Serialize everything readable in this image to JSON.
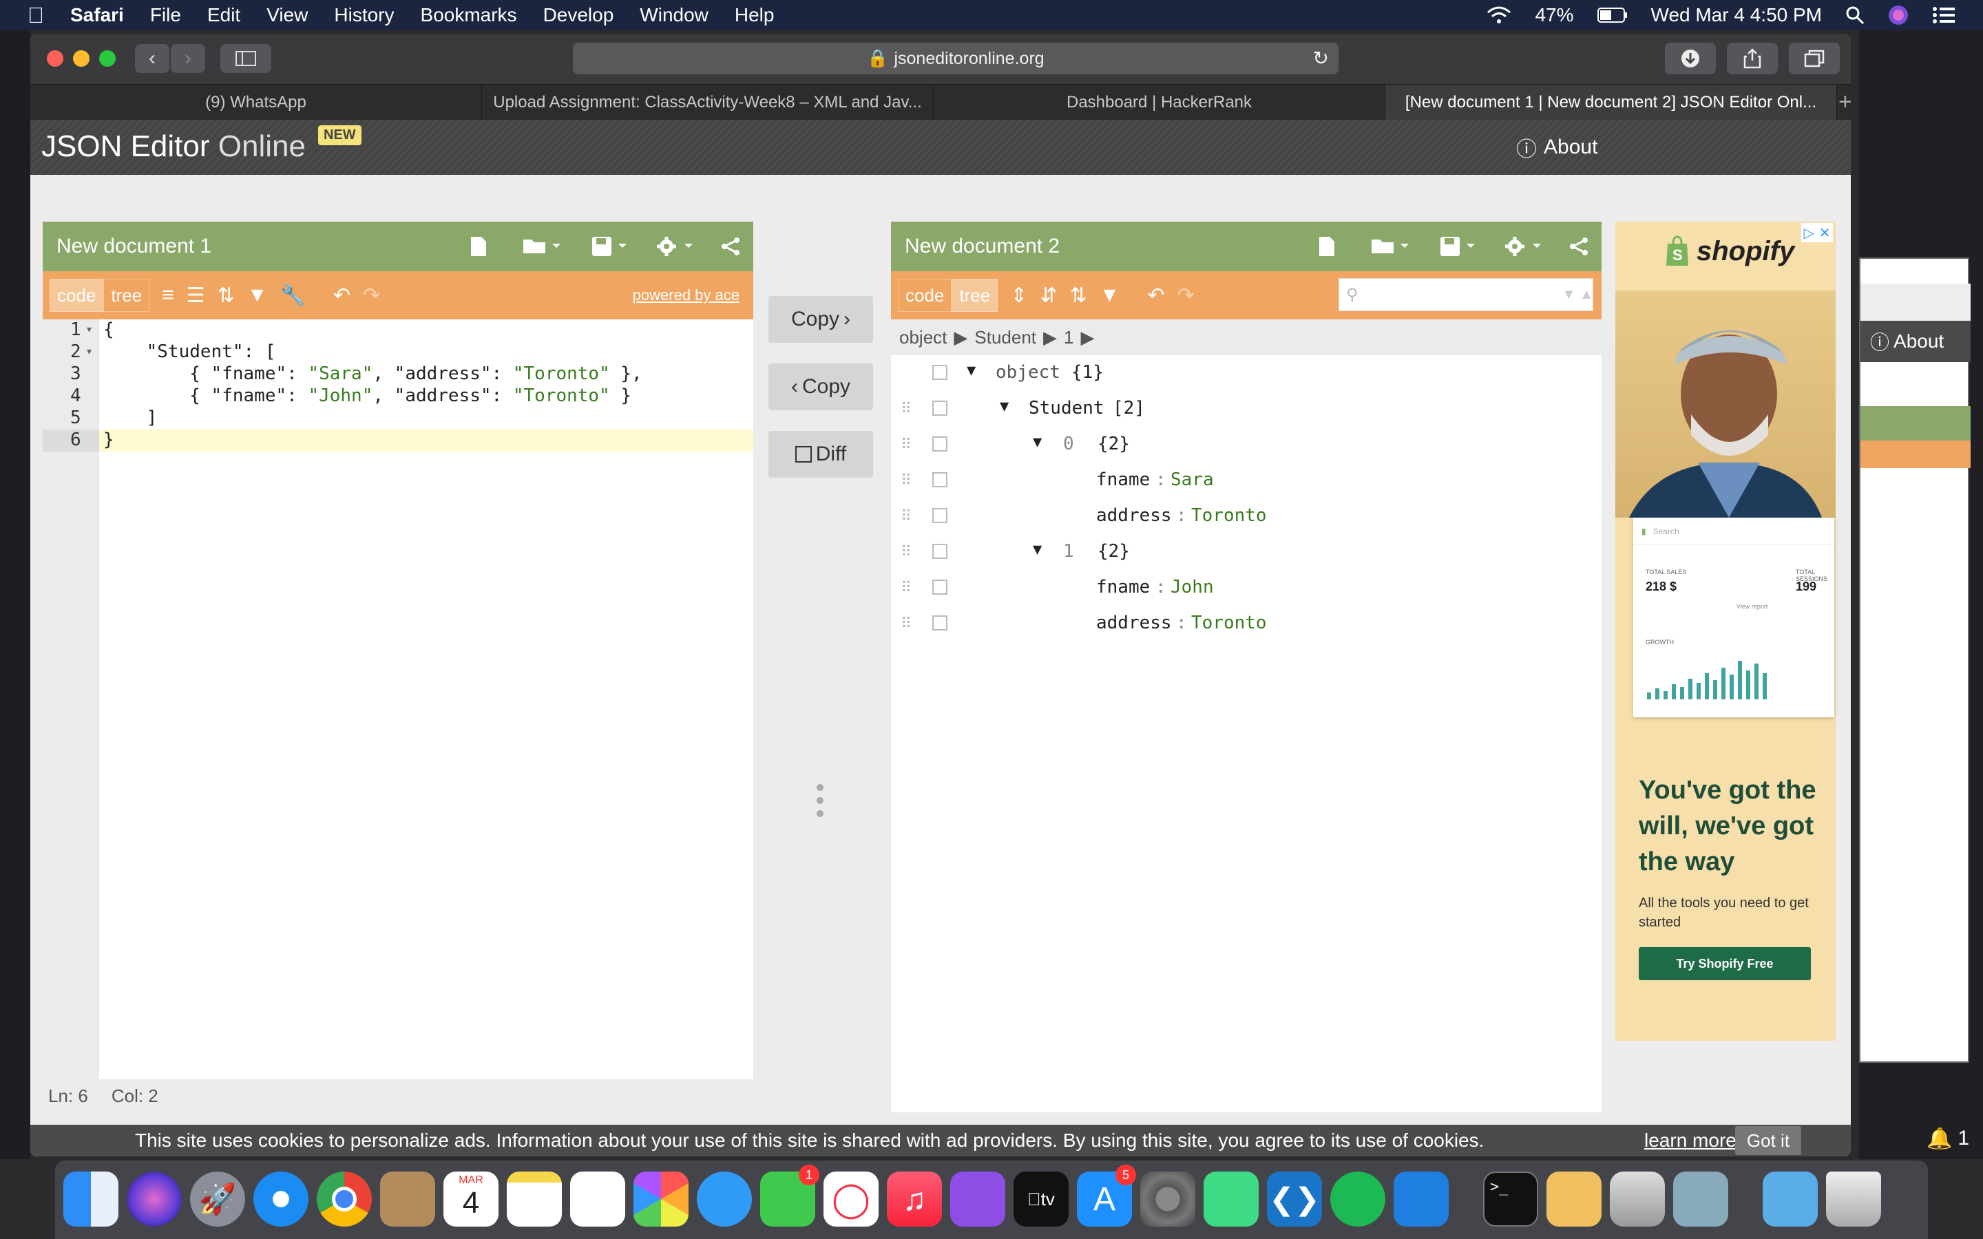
{
  "menubar": {
    "app_name": "Safari",
    "menus": [
      "File",
      "Edit",
      "View",
      "History",
      "Bookmarks",
      "Develop",
      "Window",
      "Help"
    ],
    "battery": "47%",
    "datetime": "Wed Mar 4  4:50 PM"
  },
  "browser": {
    "url": "jsoneditoronline.org",
    "tabs": [
      {
        "label": "(9) WhatsApp"
      },
      {
        "label": "Upload Assignment: ClassActivity-Week8 – XML and Jav..."
      },
      {
        "label": "Dashboard | HackerRank"
      },
      {
        "label": "[New document 1 | New document 2]  JSON Editor Onl..."
      }
    ]
  },
  "app": {
    "logo_main": "JSON Editor",
    "logo_sub": "Online",
    "badge": "NEW",
    "about": "About"
  },
  "left_panel": {
    "title": "New document 1",
    "mode_code": "code",
    "mode_tree": "tree",
    "powered_by": "powered by ace",
    "line_numbers": [
      "1",
      "2",
      "3",
      "4",
      "5",
      "6"
    ],
    "status_ln": "Ln: 6",
    "status_col": "Col: 2"
  },
  "code_lines": [
    {
      "pre": "{",
      "k1": "",
      "m1": "",
      "v1": "",
      "m2": "",
      "v2": "",
      "post": ""
    },
    {
      "pre": "    ",
      "k1": "\"Student\"",
      "m1": ": [",
      "v1": "",
      "m2": "",
      "v2": "",
      "post": ""
    },
    {
      "pre": "        { ",
      "k1": "\"fname\"",
      "m1": ": ",
      "v1": "\"Sara\"",
      "m2": ", \"address\": ",
      "v2": "\"Toronto\"",
      "post": " },"
    },
    {
      "pre": "        { ",
      "k1": "\"fname\"",
      "m1": ": ",
      "v1": "\"John\"",
      "m2": ", \"address\": ",
      "v2": "\"Toronto\"",
      "post": " }"
    },
    {
      "pre": "    ]",
      "k1": "",
      "m1": "",
      "v1": "",
      "m2": "",
      "v2": "",
      "post": ""
    },
    {
      "pre": "}",
      "k1": "",
      "m1": "",
      "v1": "",
      "m2": "",
      "v2": "",
      "post": ""
    }
  ],
  "middle": {
    "copy_right": "Copy",
    "copy_left": "Copy",
    "diff": "Diff"
  },
  "right_panel": {
    "title": "New document 2",
    "mode_code": "code",
    "mode_tree": "tree",
    "breadcrumb": [
      "object",
      "Student",
      "1"
    ],
    "search_placeholder": ""
  },
  "tree": {
    "root_label": "object",
    "root_count": "{1}",
    "student_label": "Student",
    "student_count": "[2]",
    "item0_index": "0",
    "item0_count": "{2}",
    "item1_index": "1",
    "item1_count": "{2}",
    "fname_key": "fname",
    "address_key": "address",
    "sep": ":",
    "sara": "Sara",
    "john": "John",
    "toronto": "Toronto"
  },
  "ad": {
    "brand": "shopify",
    "stat1_label": "TOTAL SALES",
    "stat1_value": "218 $",
    "stat2_label": "TOTAL SESSIONS",
    "stat2_value": "199",
    "growth_label": "GROWTH",
    "search_label": "Search",
    "view_report": "View report",
    "headline": "You've got the will, we've got the way",
    "subtext": "All the tools you need to get started",
    "cta": "Try Shopify Free"
  },
  "behind_window": {
    "about": "About"
  },
  "cookie": {
    "text": "This site uses cookies to personalize ads. Information about your use of this site is shared with ad providers. By using this site, you agree to its use of cookies.",
    "learn_more": "learn more",
    "got_it": "Got it"
  },
  "dock": {
    "calendar_month": "MAR",
    "calendar_day": "4",
    "facetime_badge": "1",
    "appstore_badge": "5",
    "notif_count": "1",
    "terminal_prompt": ">_"
  },
  "colors": {
    "menu_green": "#8aa86a",
    "toolbar_orange": "#f0a560",
    "string_green": "#3a7a1e",
    "shopify_green": "#1e6b48"
  }
}
